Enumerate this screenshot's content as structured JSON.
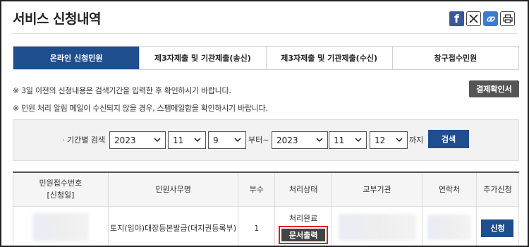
{
  "page": {
    "title": "서비스 신청내역"
  },
  "share": {
    "facebook_glyph": "f"
  },
  "tabs": [
    {
      "label": "온라인 신청민원",
      "active": true
    },
    {
      "label": "제3자제출 및 기관제출(송신)",
      "active": false
    },
    {
      "label": "제3자제출 및 기관제출(수신)",
      "active": false
    },
    {
      "label": "창구접수민원",
      "active": false
    }
  ],
  "notices": {
    "line1": "※ 3일 이전의 신청내용은 검색기간을 입력한 후 확인하시기 바랍니다.",
    "line2": "※ 민원 처리 알림 메일이 수신되지 않을 경우, 스팸메일함을 확인하시기 바랍니다."
  },
  "confirm_button": "결제확인서",
  "search": {
    "label": "· 기간별 검색",
    "from": {
      "year": "2023",
      "month": "11",
      "day": "9"
    },
    "from_suffix": "부터~",
    "to": {
      "year": "2023",
      "month": "11",
      "day": "12"
    },
    "to_suffix": "까지",
    "button": "검색"
  },
  "table": {
    "headers": {
      "receipt_no_line1": "민원접수번호",
      "receipt_no_line2": "[신청일]",
      "affair": "민원사무명",
      "copies": "부수",
      "status": "처리상태",
      "agency": "교부기관",
      "contact": "연락처",
      "extra": "추가신청"
    },
    "rows": [
      {
        "affair": "토지(임야)대장등본발급(대지권등록부)",
        "copies": "1",
        "status": "처리완료",
        "print_button": "문서출력",
        "apply_button": "신청"
      }
    ]
  },
  "colors": {
    "primary": "#1f4e8f",
    "highlight": "#e31b1b",
    "dark_button": "#444444"
  }
}
